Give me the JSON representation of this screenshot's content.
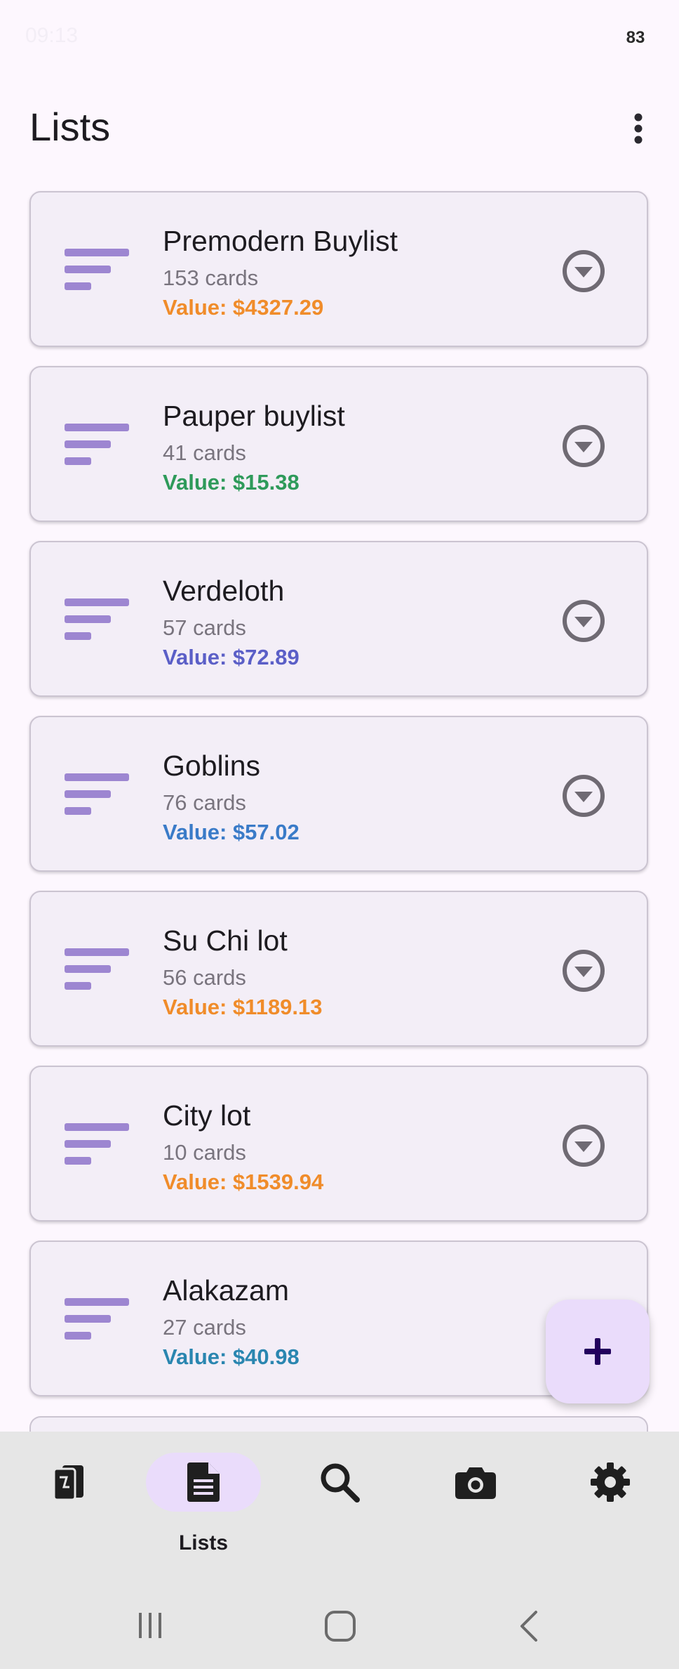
{
  "status_bar": {
    "time": "09:13",
    "battery": "83"
  },
  "header": {
    "title": "Lists"
  },
  "lists": [
    {
      "name": "Premodern Buylist",
      "count": "153 cards",
      "value": "Value: $4327.29",
      "value_color": "#f08c2a"
    },
    {
      "name": "Pauper buylist",
      "count": "41 cards",
      "value": "Value: $15.38",
      "value_color": "#2e9a5a"
    },
    {
      "name": "Verdeloth",
      "count": "57 cards",
      "value": "Value: $72.89",
      "value_color": "#5b5fc7"
    },
    {
      "name": "Goblins",
      "count": "76 cards",
      "value": "Value: $57.02",
      "value_color": "#3a7bc8"
    },
    {
      "name": "Su Chi lot",
      "count": "56 cards",
      "value": "Value: $1189.13",
      "value_color": "#f08c2a"
    },
    {
      "name": "City lot",
      "count": "10 cards",
      "value": "Value: $1539.94",
      "value_color": "#f08c2a"
    },
    {
      "name": "Alakazam",
      "count": "27 cards",
      "value": "Value: $40.98",
      "value_color": "#2a86b0"
    }
  ],
  "fab": {
    "icon": "plus-icon"
  },
  "bottom_nav": {
    "items": [
      {
        "id": "collection",
        "icon": "cards-icon",
        "label": ""
      },
      {
        "id": "lists",
        "icon": "document-icon",
        "label": "Lists",
        "active": true
      },
      {
        "id": "search",
        "icon": "search-icon",
        "label": ""
      },
      {
        "id": "scan",
        "icon": "camera-icon",
        "label": ""
      },
      {
        "id": "settings",
        "icon": "gear-icon",
        "label": ""
      }
    ]
  },
  "colors": {
    "accent": "#9d86d1",
    "fab_bg": "#eadcfb",
    "card_bg": "#f3eef7"
  }
}
